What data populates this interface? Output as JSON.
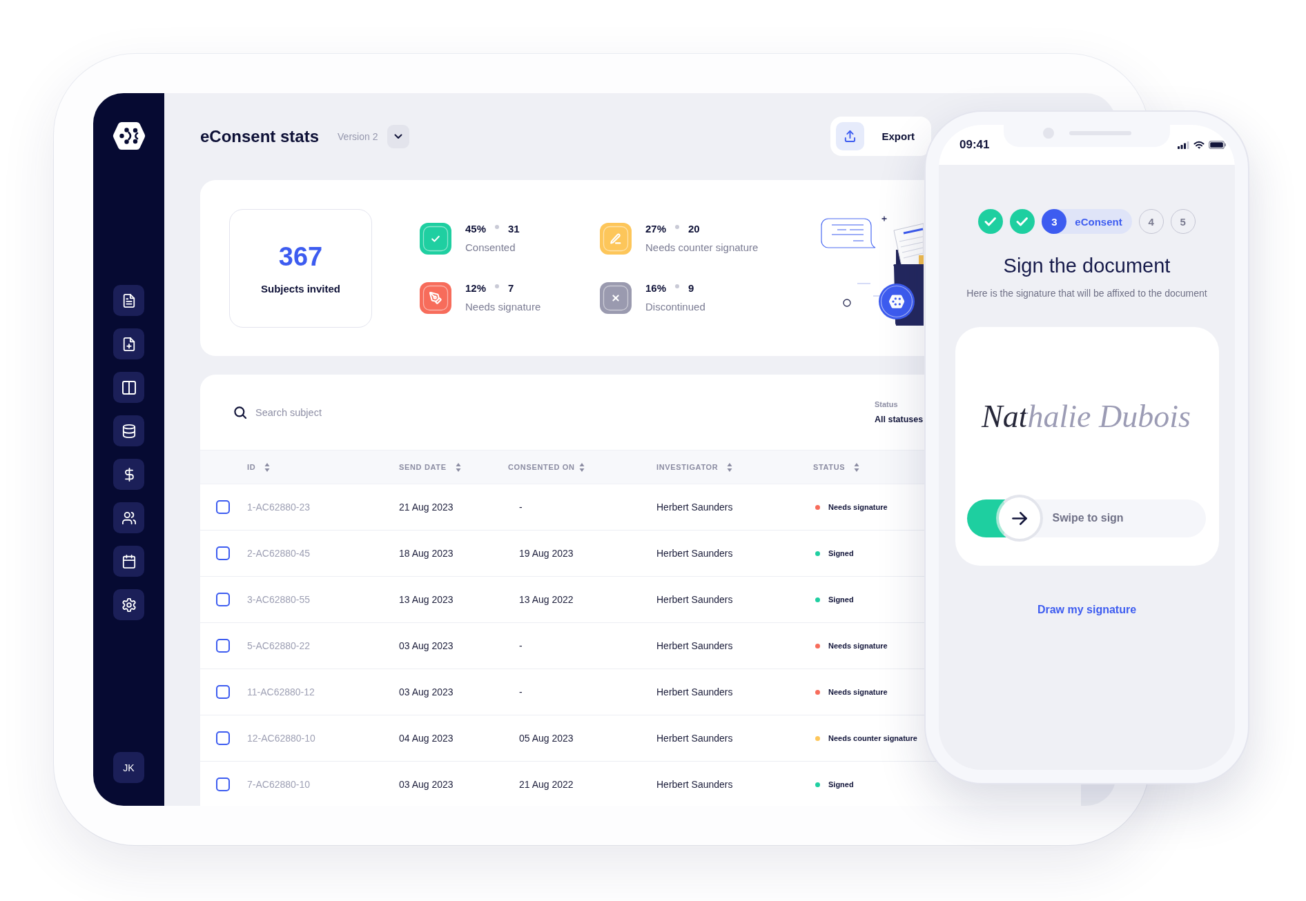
{
  "sidebar": {
    "avatar": "JK"
  },
  "header": {
    "title": "eConsent stats",
    "version": "Version 2",
    "export_button": "Export"
  },
  "stats": {
    "total": "367",
    "total_label": "Subjects invited",
    "items": [
      {
        "kind": "consented",
        "percent": "45%",
        "count": "31",
        "label": "Consented",
        "color": "#1fcfa1"
      },
      {
        "kind": "counter_signature",
        "percent": "27%",
        "count": "20",
        "label": "Needs counter signature",
        "color": "#fdc65a"
      },
      {
        "kind": "signature",
        "percent": "12%",
        "count": "7",
        "label": "Needs signature",
        "color": "#f76c5b"
      },
      {
        "kind": "discontinued",
        "percent": "16%",
        "count": "9",
        "label": "Discontinued",
        "color": "#9a9aaf"
      }
    ]
  },
  "table": {
    "search": {
      "placeholder": "Search subject"
    },
    "filter": {
      "label": "Status",
      "value": "All statuses"
    },
    "columns": [
      "ID",
      "SEND DATE",
      "CONSENTED ON",
      "INVESTIGATOR",
      "STATUS"
    ],
    "rows": [
      {
        "checked": false,
        "id": "1-AC62880-23",
        "send_date": "21 Aug 2023",
        "consented_on": "-",
        "investigator": "Herbert Saunders",
        "status": {
          "label": "Needs signature",
          "color": "#f76c5b"
        }
      },
      {
        "checked": false,
        "id": "2-AC62880-45",
        "send_date": "18 Aug 2023",
        "consented_on": "19 Aug 2023",
        "investigator": "Herbert Saunders",
        "status": {
          "label": "Signed",
          "color": "#1fcfa1"
        }
      },
      {
        "checked": false,
        "id": "3-AC62880-55",
        "send_date": "13 Aug 2023",
        "consented_on": "13 Aug 2022",
        "investigator": "Herbert Saunders",
        "status": {
          "label": "Signed",
          "color": "#1fcfa1"
        }
      },
      {
        "checked": false,
        "id": "5-AC62880-22",
        "send_date": "03 Aug 2023",
        "consented_on": "-",
        "investigator": "Herbert Saunders",
        "status": {
          "label": "Needs signature",
          "color": "#f76c5b"
        }
      },
      {
        "checked": false,
        "id": "11-AC62880-12",
        "send_date": "03 Aug 2023",
        "consented_on": "-",
        "investigator": "Herbert Saunders",
        "status": {
          "label": "Needs signature",
          "color": "#f76c5b"
        }
      },
      {
        "checked": false,
        "id": "12-AC62880-10",
        "send_date": "04 Aug 2023",
        "consented_on": "05 Aug 2023",
        "investigator": "Herbert Saunders",
        "status": {
          "label": "Needs counter signature",
          "color": "#fdc65a"
        }
      },
      {
        "checked": false,
        "id": "7-AC62880-10",
        "send_date": "03 Aug 2023",
        "consented_on": "21 Aug 2022",
        "investigator": "Herbert Saunders",
        "status": {
          "label": "Signed",
          "color": "#1fcfa1"
        }
      }
    ]
  },
  "phone": {
    "status_bar": {
      "time": "09:41"
    },
    "steps": [
      {
        "kind": "done"
      },
      {
        "kind": "done"
      },
      {
        "kind": "current",
        "number": "3",
        "label": "eConsent"
      },
      {
        "kind": "upcoming",
        "number": "4"
      },
      {
        "kind": "upcoming",
        "number": "5"
      }
    ],
    "title": "Sign the document",
    "subtitle": "Here is the signature that will be affixed to the document",
    "signature": "Nathalie Dubois",
    "swipe": {
      "label": "Swipe to sign",
      "level": 0.22
    },
    "link": "Draw my signature"
  }
}
